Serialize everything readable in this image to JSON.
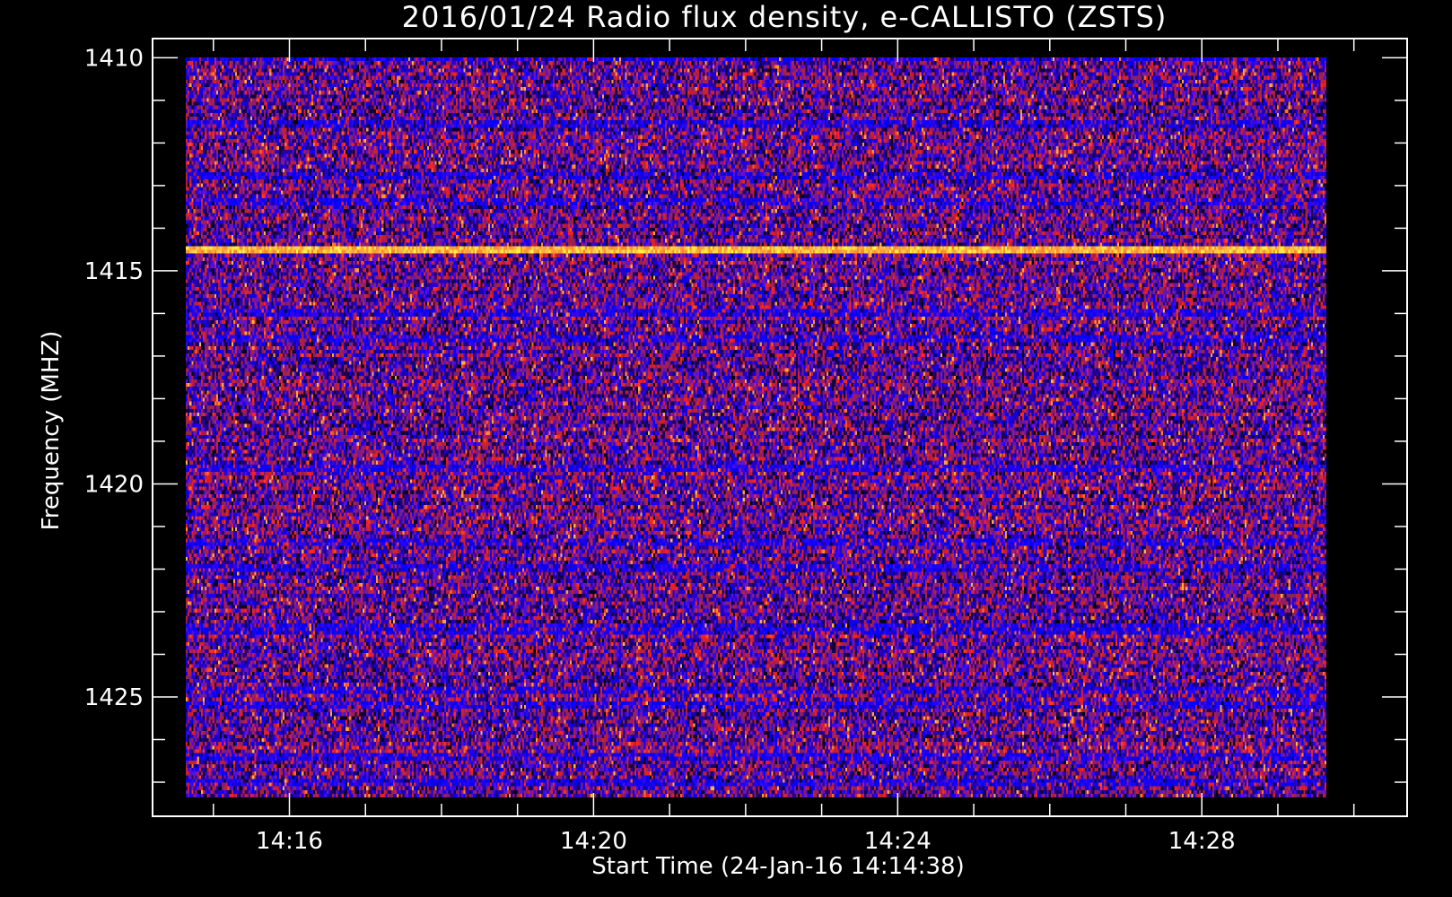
{
  "chart_data": {
    "type": "heatmap",
    "title": "2016/01/24  Radio flux density, e-CALLISTO (ZSTS)",
    "xlabel": "Start Time (24-Jan-16 14:14:38)",
    "ylabel": "Frequency (MHZ)",
    "x_ticks": [
      "14:16",
      "14:20",
      "14:24",
      "14:28"
    ],
    "y_ticks": [
      "1410",
      "1415",
      "1420",
      "1425"
    ],
    "x_tick_values_minutes": [
      16,
      20,
      24,
      28
    ],
    "y_tick_values_mhz": [
      1410,
      1415,
      1420,
      1425
    ],
    "x_range_minutes": [
      14.2,
      30.7
    ],
    "y_range_mhz": [
      1409.55,
      1427.8
    ],
    "data_x_range_minutes": [
      14.633,
      29.633
    ],
    "data_y_range_mhz": [
      1410,
      1427.35
    ],
    "x_unit": "time of day on 24-Jan-16",
    "y_unit": "MHz",
    "frequency_channels": 200,
    "time_steps": 600,
    "bright_band_mhz": 1414.5,
    "strong_bands_mhz": [
      1410.0,
      1411.6,
      1412.8,
      1413.4,
      1416.0,
      1416.6,
      1419.6,
      1421.4,
      1422.0,
      1423.4,
      1424.8,
      1425.2,
      1426.4,
      1427.0
    ],
    "colormap": [
      "#000000",
      "#1a0050",
      "#2a00c0",
      "#0000ff",
      "#5a10e0",
      "#8a2060",
      "#c02030",
      "#ff2020",
      "#ff7020",
      "#ffb040",
      "#ffff40"
    ],
    "grid": false,
    "legend": "none"
  },
  "colors": {
    "background": "#000000",
    "axes": "#ffffff",
    "text": "#ffffff"
  }
}
